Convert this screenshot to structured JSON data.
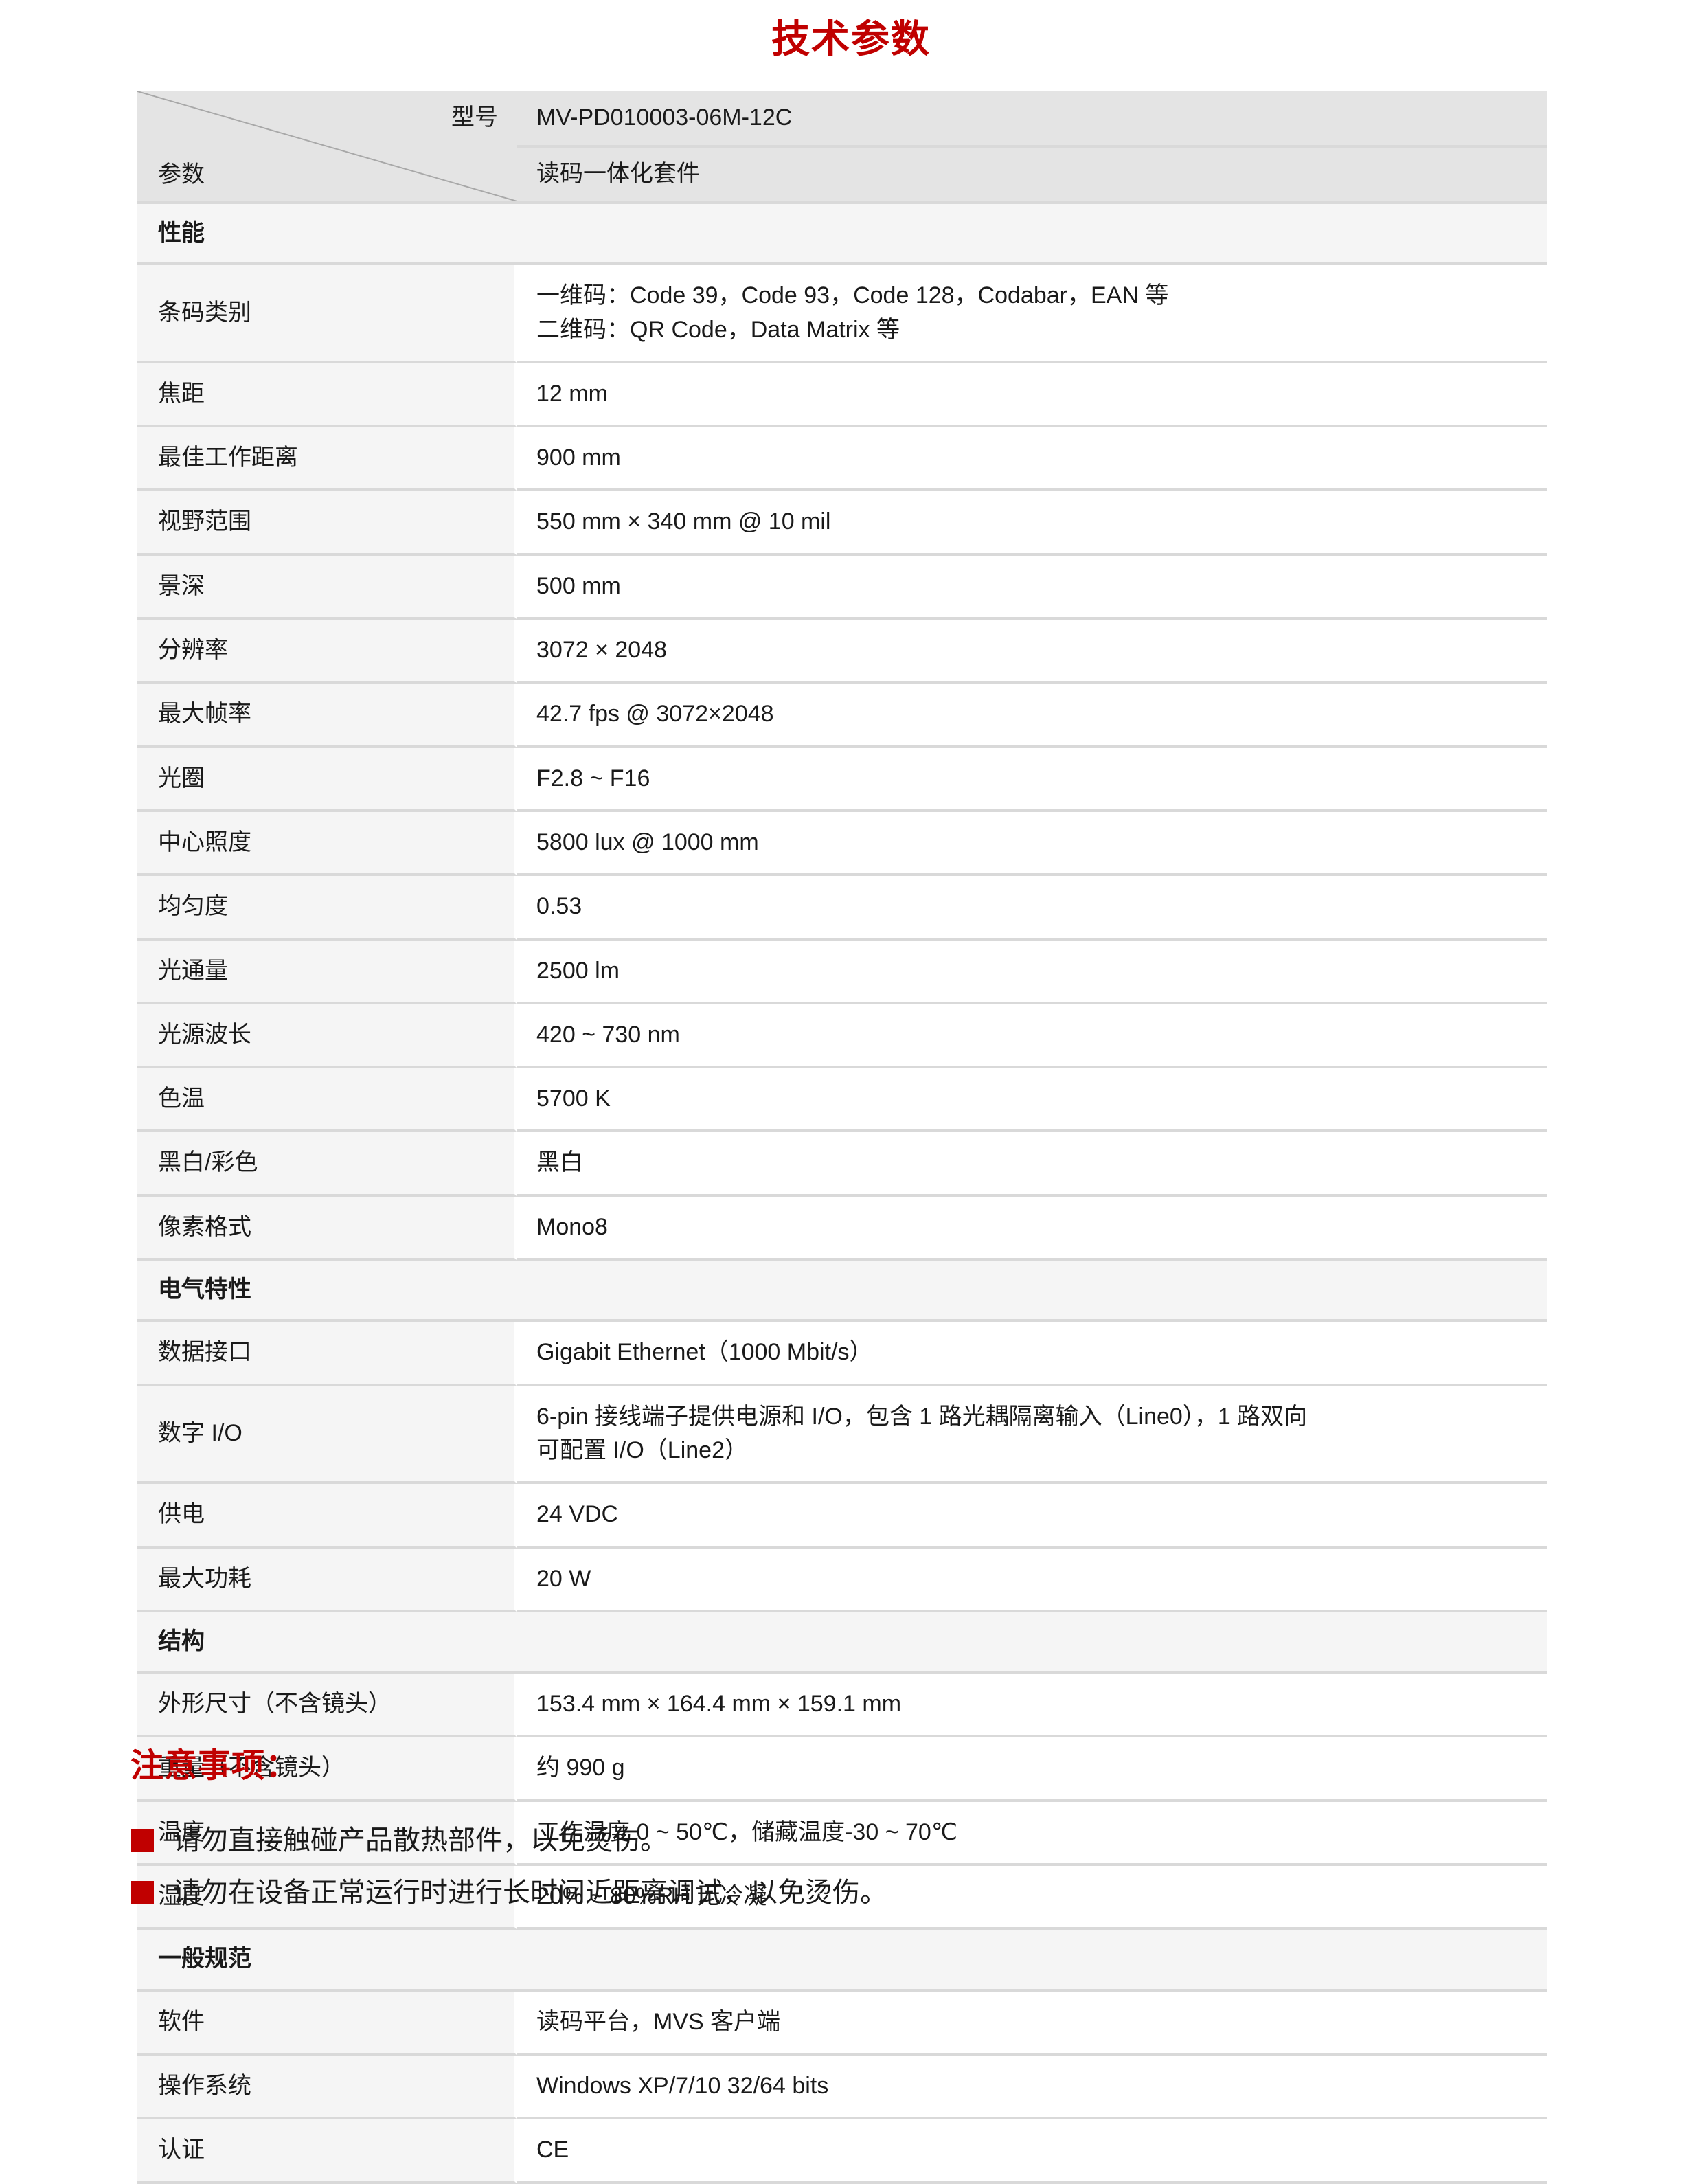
{
  "document": {
    "title": "技术参数",
    "title_color": "#c00000"
  },
  "table": {
    "header": {
      "corner_top_label": "型号",
      "corner_bottom_label": "参数",
      "model_value": "MV-PD010003-06M-12C",
      "product_value": "读码一体化套件"
    },
    "sections": [
      {
        "name": "性能",
        "rows": [
          {
            "label": "条码类别",
            "value_lines": [
              "一维码：Code 39，Code 93，Code 128，Codabar，EAN 等",
              "二维码：QR Code，Data Matrix 等"
            ]
          },
          {
            "label": "焦距",
            "value_lines": [
              "12 mm"
            ]
          },
          {
            "label": "最佳工作距离",
            "value_lines": [
              "900 mm"
            ]
          },
          {
            "label": "视野范围",
            "value_lines": [
              "550 mm × 340 mm @ 10 mil"
            ]
          },
          {
            "label": "景深",
            "value_lines": [
              "500 mm"
            ]
          },
          {
            "label": "分辨率",
            "value_lines": [
              "3072 × 2048"
            ]
          },
          {
            "label": "最大帧率",
            "value_lines": [
              "42.7 fps @ 3072×2048"
            ]
          },
          {
            "label": "光圈",
            "value_lines": [
              "F2.8 ~ F16"
            ]
          },
          {
            "label": "中心照度",
            "value_lines": [
              "5800 lux @ 1000 mm"
            ]
          },
          {
            "label": "均匀度",
            "value_lines": [
              "0.53"
            ]
          },
          {
            "label": "光通量",
            "value_lines": [
              "2500 lm"
            ]
          },
          {
            "label": "光源波长",
            "value_lines": [
              "420 ~ 730 nm"
            ]
          },
          {
            "label": "色温",
            "value_lines": [
              "5700 K"
            ]
          },
          {
            "label": "黑白/彩色",
            "value_lines": [
              "黑白"
            ]
          },
          {
            "label": "像素格式",
            "value_lines": [
              "Mono8"
            ]
          }
        ]
      },
      {
        "name": "电气特性",
        "rows": [
          {
            "label": "数据接口",
            "value_lines": [
              "Gigabit Ethernet（1000 Mbit/s）"
            ]
          },
          {
            "label": "数字 I/O",
            "value_lines": [
              "6-pin 接线端子提供电源和 I/O，包含 1 路光耦隔离输入（Line0），1 路双向",
              "可配置 I/O（Line2）"
            ]
          },
          {
            "label": "供电",
            "value_lines": [
              "24 VDC"
            ]
          },
          {
            "label": "最大功耗",
            "value_lines": [
              "20 W"
            ]
          }
        ]
      },
      {
        "name": "结构",
        "rows": [
          {
            "label": "外形尺寸（不含镜头）",
            "value_lines": [
              "153.4 mm × 164.4 mm × 159.1 mm"
            ]
          },
          {
            "label": "重量（不含镜头）",
            "value_lines": [
              "约 990 g"
            ]
          },
          {
            "label": "温度",
            "value_lines": [
              "工作温度 0 ~ 50℃，储藏温度-30 ~ 70℃"
            ]
          },
          {
            "label": "湿度",
            "value_lines": [
              "20% ~ 80%RH 无冷凝"
            ]
          }
        ]
      },
      {
        "name": "一般规范",
        "rows": [
          {
            "label": "软件",
            "value_lines": [
              "读码平台，MVS 客户端"
            ]
          },
          {
            "label": "操作系统",
            "value_lines": [
              "Windows XP/7/10 32/64 bits"
            ]
          },
          {
            "label": "认证",
            "value_lines": [
              "CE"
            ]
          }
        ]
      }
    ]
  },
  "notes": {
    "title": "注意事项：",
    "items": [
      "请勿直接触碰产品散热部件，以免烫伤。",
      "请勿在设备正常运行时进行长时间近距离调试，以免烫伤。"
    ]
  }
}
